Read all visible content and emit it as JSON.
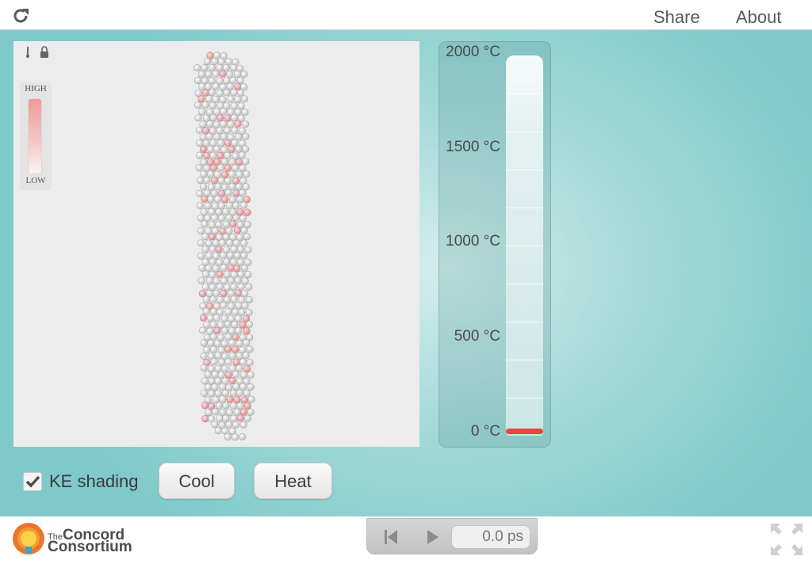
{
  "header": {
    "share_label": "Share",
    "about_label": "About",
    "reload_icon": "reload-icon"
  },
  "simulation": {
    "legend": {
      "high_label": "HIGH",
      "low_label": "LOW"
    }
  },
  "thermometer": {
    "labels": [
      "2000 °C",
      "1500 °C",
      "1000 °C",
      "500 °C",
      "0 °C"
    ],
    "max_celsius": 2000,
    "current_celsius": 0,
    "fill_color": "#e44840"
  },
  "controls": {
    "ke_shading_label": "KE shading",
    "ke_shading_checked": true,
    "cool_label": "Cool",
    "heat_label": "Heat"
  },
  "footer": {
    "logo_the": "The",
    "logo_line1": "Concord",
    "logo_line2": "Consortium",
    "time_display": "0.0 ps"
  },
  "colors": {
    "accent": "#80c9cb",
    "atom_hot": "#e28f8f",
    "atom_cold": "#d4d4d4"
  }
}
